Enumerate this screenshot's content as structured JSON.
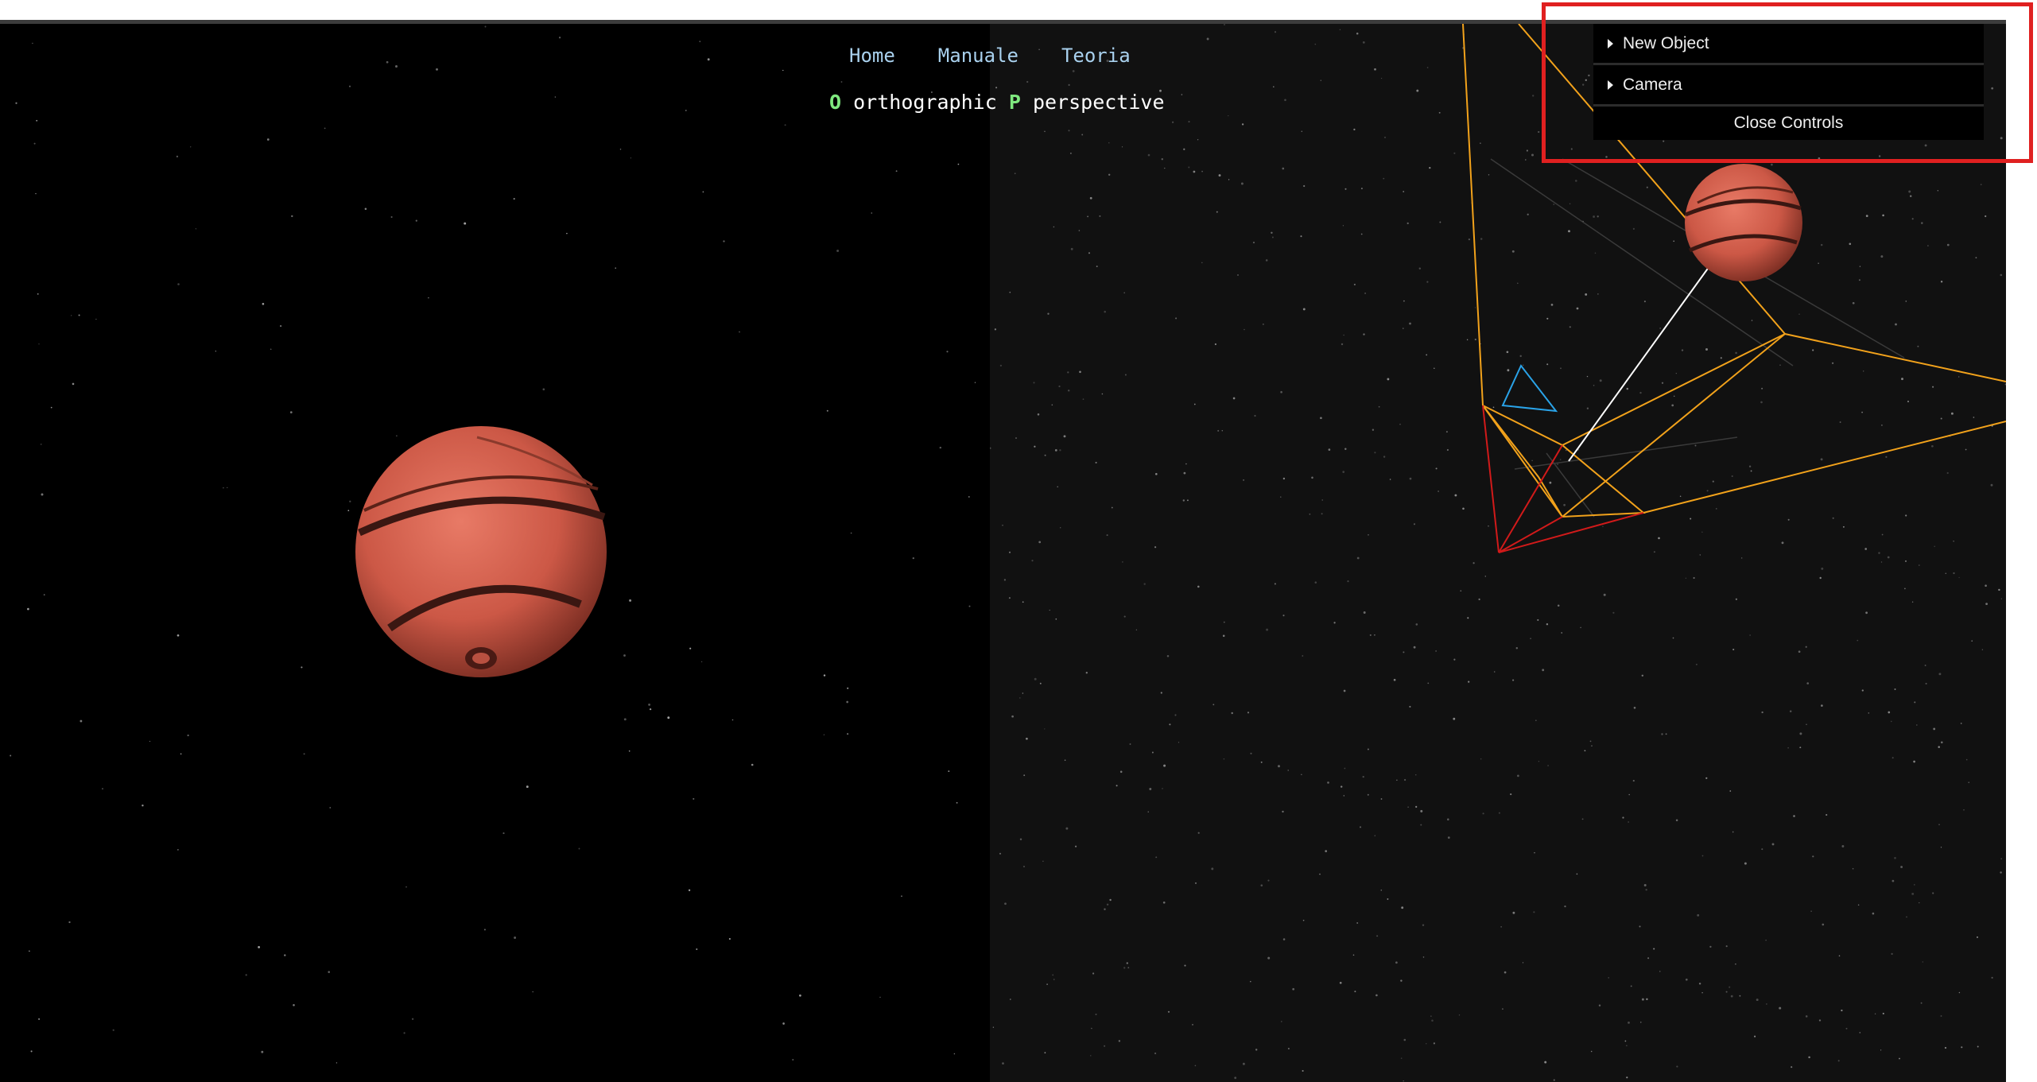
{
  "nav": {
    "home": "Home",
    "manuale": "Manuale",
    "teoria": "Teoria"
  },
  "modes": {
    "ortho_key": "O",
    "ortho_label": "orthographic",
    "persp_key": "P",
    "persp_label": "perspective"
  },
  "controls": {
    "new_object": "New Object",
    "camera": "Camera",
    "close": "Close Controls"
  },
  "colors": {
    "planet": "#d35f4d",
    "frustum": "#f2a21b",
    "camera_lines": "#d11a1a",
    "camera_helper": "#2aa3e8",
    "highlight": "#e02020",
    "nav_link": "#a9d1ee",
    "mode_key": "#7fe87f"
  }
}
